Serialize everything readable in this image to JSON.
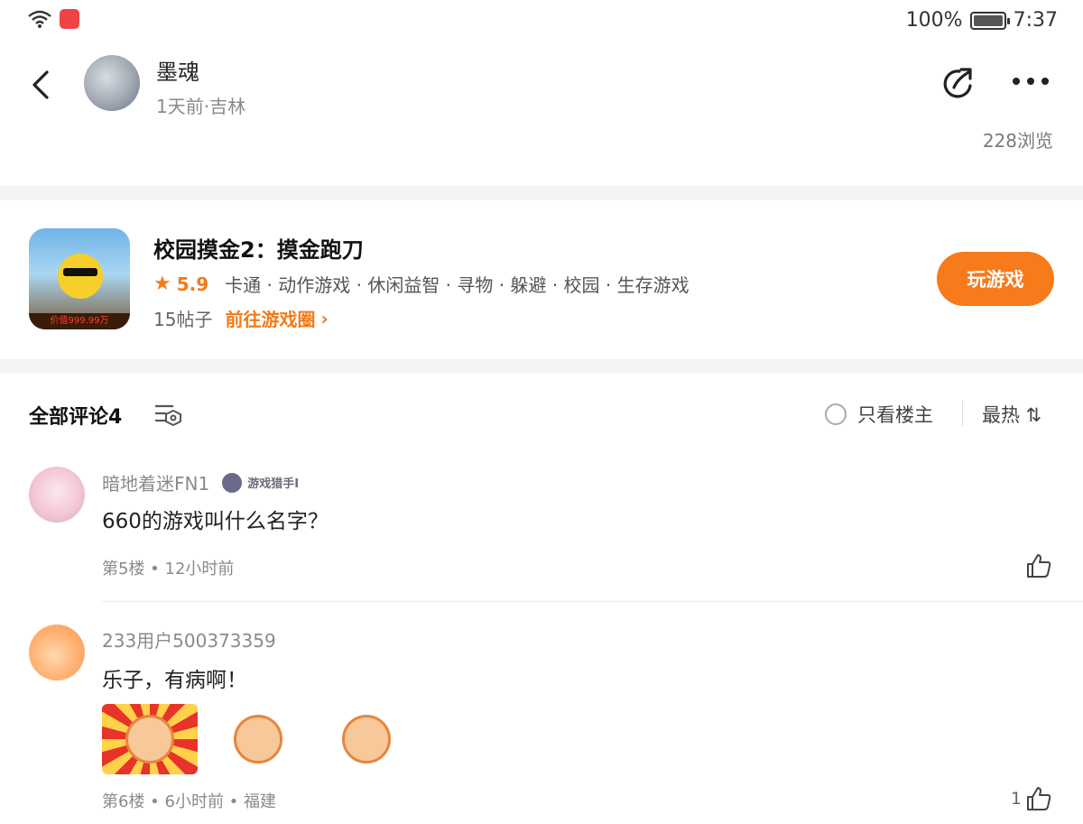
{
  "status_bar": {
    "battery": "100%",
    "time": "7:37"
  },
  "post": {
    "author_name": "墨魂",
    "author_meta": "1天前·吉林",
    "views": "228浏览"
  },
  "game": {
    "title": "校园摸金2：摸金跑刀",
    "rating": "5.9",
    "tags": "卡通 · 动作游戏 · 休闲益智 · 寻物 · 躲避 · 校园 · 生存游戏",
    "posts": "15帖子",
    "goto_label": "前往游戏圈",
    "play_label": "玩游戏",
    "icon_banner": "价值999.99万"
  },
  "comments_header": {
    "title": "全部评论4",
    "only_op_label": "只看楼主",
    "sort_label": "最热 ⇅"
  },
  "comments": [
    {
      "user": "暗地着迷FN1",
      "badge": "游戏猎手I",
      "text": "660的游戏叫什么名字？",
      "meta": "第5楼 • 12小时前",
      "likes": ""
    },
    {
      "user": "233用户500373359",
      "badge": "",
      "text": "乐子，有病啊！",
      "meta": "第6楼 • 6小时前 • 福建",
      "likes": "1"
    }
  ],
  "colors": {
    "accent": "#f77a1b",
    "divider_band": "#f4f4f6"
  }
}
